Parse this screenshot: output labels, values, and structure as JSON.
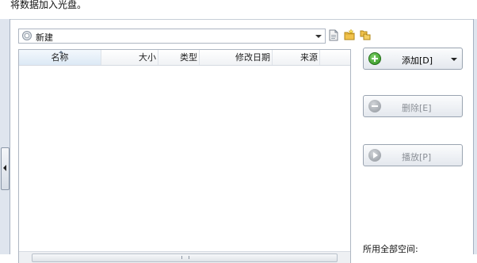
{
  "instruction": "将数据加入光盘。",
  "path_combo": {
    "value": "新建",
    "icon": "disc-icon"
  },
  "toolbar": {
    "icons": [
      "new-file-icon",
      "new-folder-icon",
      "copy-icon"
    ]
  },
  "file_list": {
    "columns": [
      "名称",
      "大小",
      "类型",
      "修改日期",
      "来源"
    ],
    "rows": []
  },
  "buttons": {
    "add": "添加[D]",
    "remove": "删除[E]",
    "play": "播放[P]"
  },
  "space_label": "所用全部空间:",
  "colors": {
    "add_icon": "#2b8c1d",
    "disabled_text": "#8a8f96"
  }
}
